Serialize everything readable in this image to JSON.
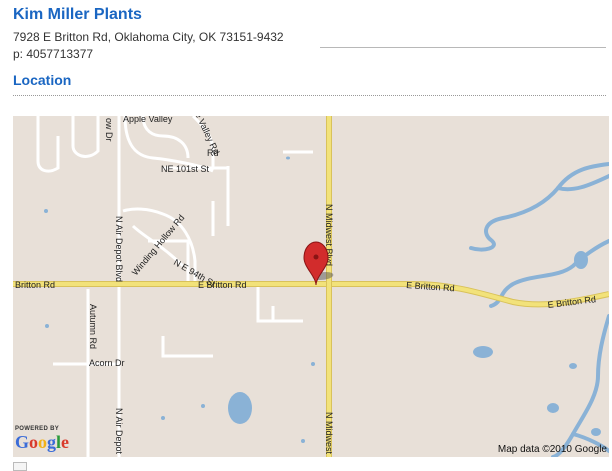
{
  "business": {
    "name": "Kim Miller Plants",
    "address": "7928 E Britton Rd, Oklahoma City, OK 73151-9432",
    "phone": "p: 4057713377"
  },
  "section": {
    "location_heading": "Location"
  },
  "map": {
    "streets": {
      "britton_left": "Britton Rd",
      "britton_mid": "E Britton Rd",
      "britton_right1": "E Britton Rd",
      "britton_right2": "E Britton Rd",
      "midwest_top": "N Midwest Blvd",
      "midwest_bottom": "N Midwest",
      "air_depot_top": "N Air Depot Blvd",
      "air_depot_bottom": "N Air Depot",
      "winding_hollow": "Winding Hollow Rd",
      "ne_94th": "N E 94th St",
      "ne_101st": "NE 101st St",
      "apple_valley": "Apple Valley",
      "valley_rd": "e Valley Rd",
      "autumn_rd": "Autumn Rd",
      "acorn_dr": "Acorn Dr",
      "rd_top": "Rd",
      "ow_dr": "ow Dr"
    },
    "powered_by": "POWERED BY",
    "google_logo": "Google",
    "copyright": "Map data ©2010 Google",
    "colors": {
      "road_major": "#f2e27a",
      "road_edge": "#d9c25a",
      "water": "#8ab2d6",
      "land": "#e8e0d8"
    },
    "marker_icon": "map-pin-icon"
  }
}
